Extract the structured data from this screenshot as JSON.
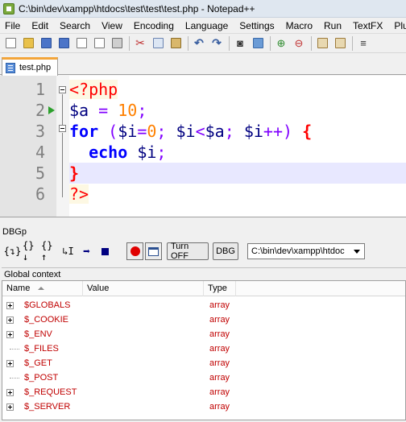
{
  "window": {
    "title": "C:\\bin\\dev\\xampp\\htdocs\\test\\test\\test.php - Notepad++"
  },
  "menu": [
    "File",
    "Edit",
    "Search",
    "View",
    "Encoding",
    "Language",
    "Settings",
    "Macro",
    "Run",
    "TextFX",
    "Plug"
  ],
  "tab": {
    "label": "test.php"
  },
  "editor": {
    "line_numbers": [
      "1",
      "2",
      "3",
      "4",
      "5",
      "6"
    ],
    "lines": [
      {
        "tokens": [
          [
            "php",
            "<?php"
          ]
        ]
      },
      {
        "tokens": [
          [
            "var",
            "$a"
          ],
          [
            "op",
            " = "
          ],
          [
            "num",
            "10"
          ],
          [
            "op",
            ";"
          ]
        ]
      },
      {
        "tokens": [
          [
            "kw",
            "for"
          ],
          [
            "op",
            " ("
          ],
          [
            "var",
            "$i"
          ],
          [
            "op",
            "="
          ],
          [
            "num",
            "0"
          ],
          [
            "op",
            "; "
          ],
          [
            "var",
            "$i"
          ],
          [
            "op",
            "<"
          ],
          [
            "var",
            "$a"
          ],
          [
            "op",
            "; "
          ],
          [
            "var",
            "$i"
          ],
          [
            "op",
            "++) "
          ],
          [
            "brace",
            "{"
          ]
        ]
      },
      {
        "tokens": [
          [
            "op",
            "  "
          ],
          [
            "kw",
            "echo"
          ],
          [
            "op",
            " "
          ],
          [
            "var",
            "$i"
          ],
          [
            "op",
            ";"
          ]
        ]
      },
      {
        "tokens": [
          [
            "brace",
            "}"
          ]
        ]
      },
      {
        "tokens": [
          [
            "php",
            "?>"
          ]
        ]
      }
    ],
    "current_line": 5,
    "breakpoint_line": 2
  },
  "dbgp": {
    "panel_title": "DBGp",
    "turn_off_label": "Turn OFF",
    "dbg_label": "DBG",
    "path_value": "C:\\bin\\dev\\xampp\\htdoc",
    "context_title": "Global context",
    "columns": {
      "name": "Name",
      "value": "Value",
      "type": "Type"
    },
    "rows": [
      {
        "name": "$GLOBALS",
        "value": "",
        "type": "array",
        "expandable": true
      },
      {
        "name": "$_COOKIE",
        "value": "",
        "type": "array",
        "expandable": true
      },
      {
        "name": "$_ENV",
        "value": "",
        "type": "array",
        "expandable": true
      },
      {
        "name": "$_FILES",
        "value": "",
        "type": "array",
        "expandable": false
      },
      {
        "name": "$_GET",
        "value": "",
        "type": "array",
        "expandable": true
      },
      {
        "name": "$_POST",
        "value": "",
        "type": "array",
        "expandable": false
      },
      {
        "name": "$_REQUEST",
        "value": "",
        "type": "array",
        "expandable": true
      },
      {
        "name": "$_SERVER",
        "value": "",
        "type": "array",
        "expandable": true
      }
    ]
  }
}
